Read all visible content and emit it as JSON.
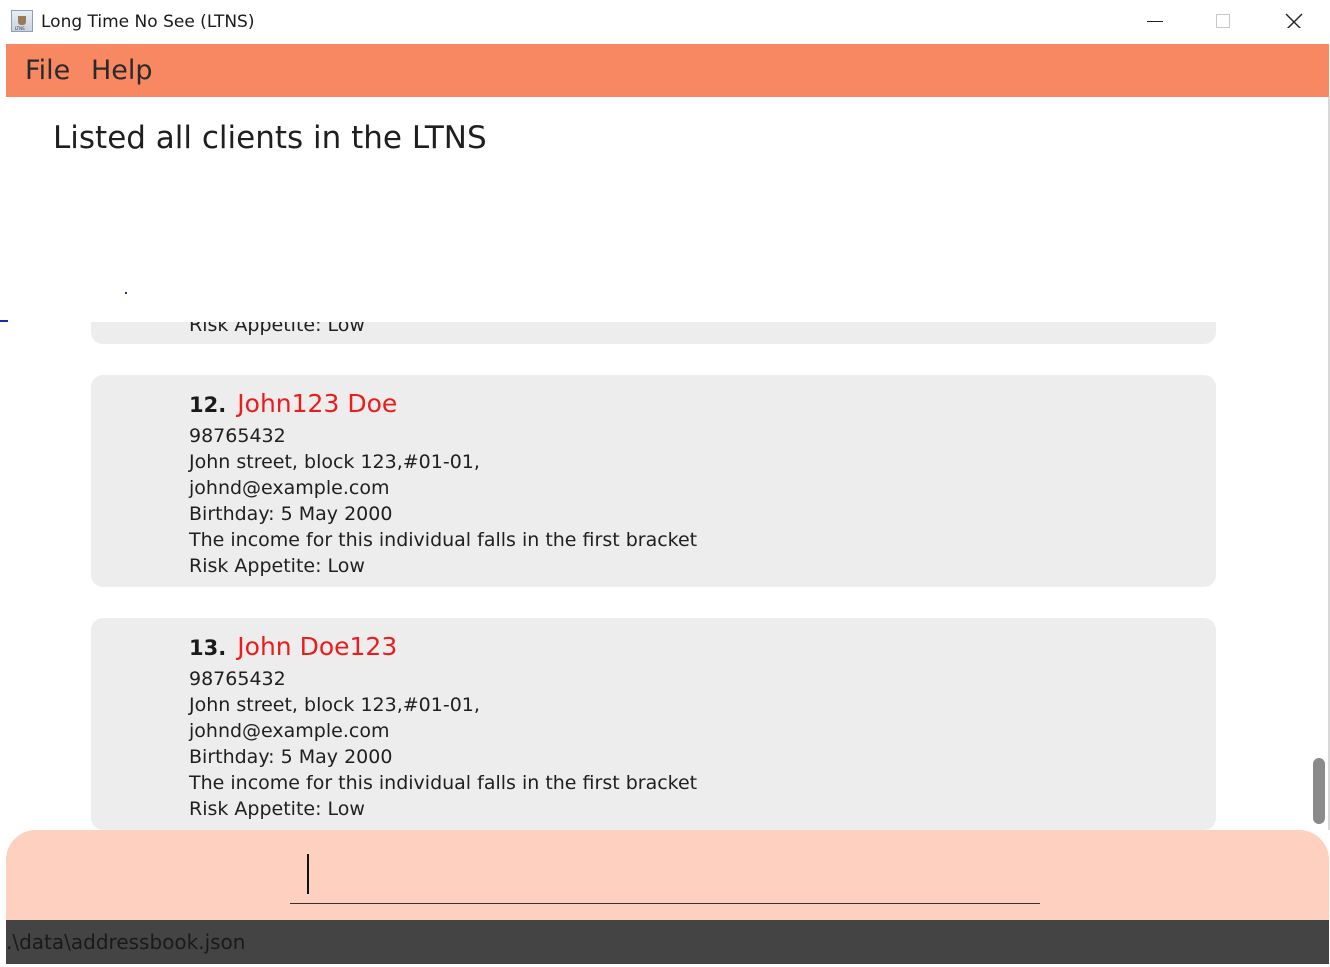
{
  "window": {
    "title": "Long Time No See (LTNS)",
    "icon": "ltns-app-icon",
    "icon_text": "LTNS"
  },
  "menu": {
    "items": [
      {
        "label": "File"
      },
      {
        "label": "Help"
      }
    ]
  },
  "result": {
    "message": "Listed all clients in the LTNS"
  },
  "clients": {
    "partial_last_line": "Risk Appetite: Low",
    "cards": [
      {
        "index": "12.",
        "name": "John123 Doe",
        "phone": "98765432",
        "address": "John street, block 123,#01-01,",
        "email": "johnd@example.com",
        "birthday": "Birthday: 5 May 2000",
        "income": "The income for this individual falls in the first bracket",
        "risk": "Risk Appetite: Low"
      },
      {
        "index": "13.",
        "name": "John Doe123",
        "phone": "98765432",
        "address": "John street, block 123,#01-01,",
        "email": "johnd@example.com",
        "birthday": "Birthday: 5 May 2000",
        "income": "The income for this individual falls in the first bracket",
        "risk": "Risk Appetite: Low"
      }
    ]
  },
  "command": {
    "value": ""
  },
  "status": {
    "path": ".\\data\\addressbook.json"
  },
  "colors": {
    "menu_bg": "#f88862",
    "command_bg": "#fed0bf",
    "status_bg": "#444444",
    "card_bg": "#ededed",
    "name_color": "#ed1c1c"
  }
}
